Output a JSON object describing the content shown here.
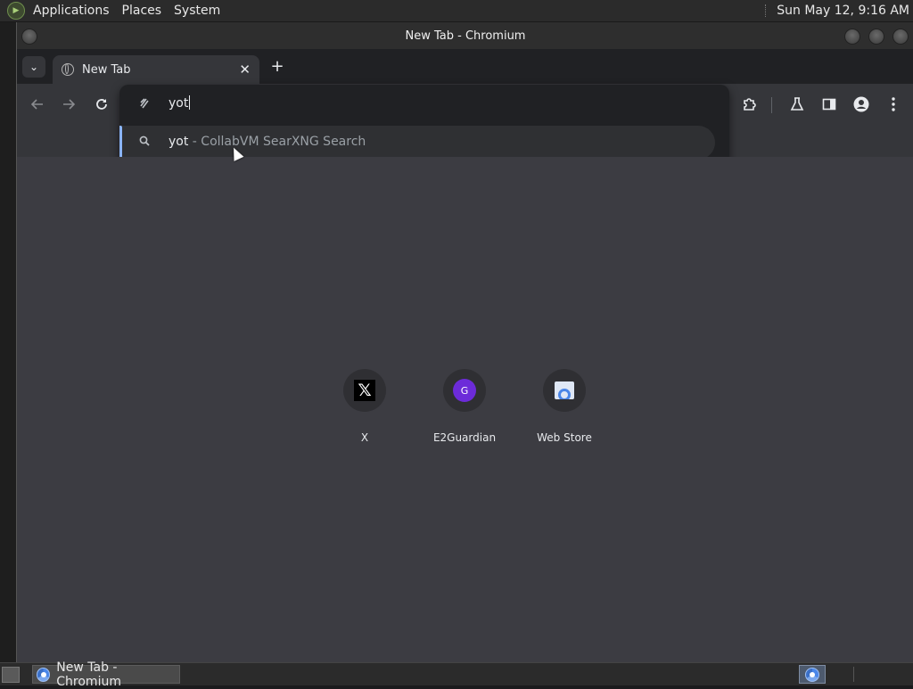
{
  "top_panel": {
    "menus": [
      "Applications",
      "Places",
      "System"
    ],
    "clock": "Sun May 12,  9:16 AM"
  },
  "window": {
    "title": "New Tab - Chromium"
  },
  "tabs": [
    {
      "title": "New Tab",
      "icon": "globe-icon",
      "close": "✕"
    }
  ],
  "new_tab_symbol": "+",
  "omnibox": {
    "value": "yot",
    "suggestion": {
      "query": "yot",
      "description": " - CollabVM SearXNG Search"
    }
  },
  "shortcuts": [
    {
      "label": "X",
      "icon": "x-logo-icon"
    },
    {
      "label": "E2Guardian",
      "icon": "e2guardian-icon",
      "letter": "G"
    },
    {
      "label": "Web Store",
      "icon": "web-store-icon"
    }
  ],
  "taskbar": {
    "task_title": "New Tab - Chromium"
  },
  "colors": {
    "window_bg": "#3c3c42",
    "toolbar_bg": "#35363a",
    "omnibox_bg": "#202124",
    "suggestion_accent": "#8ab4f8",
    "e2guardian_purple": "#6c2bd9"
  }
}
